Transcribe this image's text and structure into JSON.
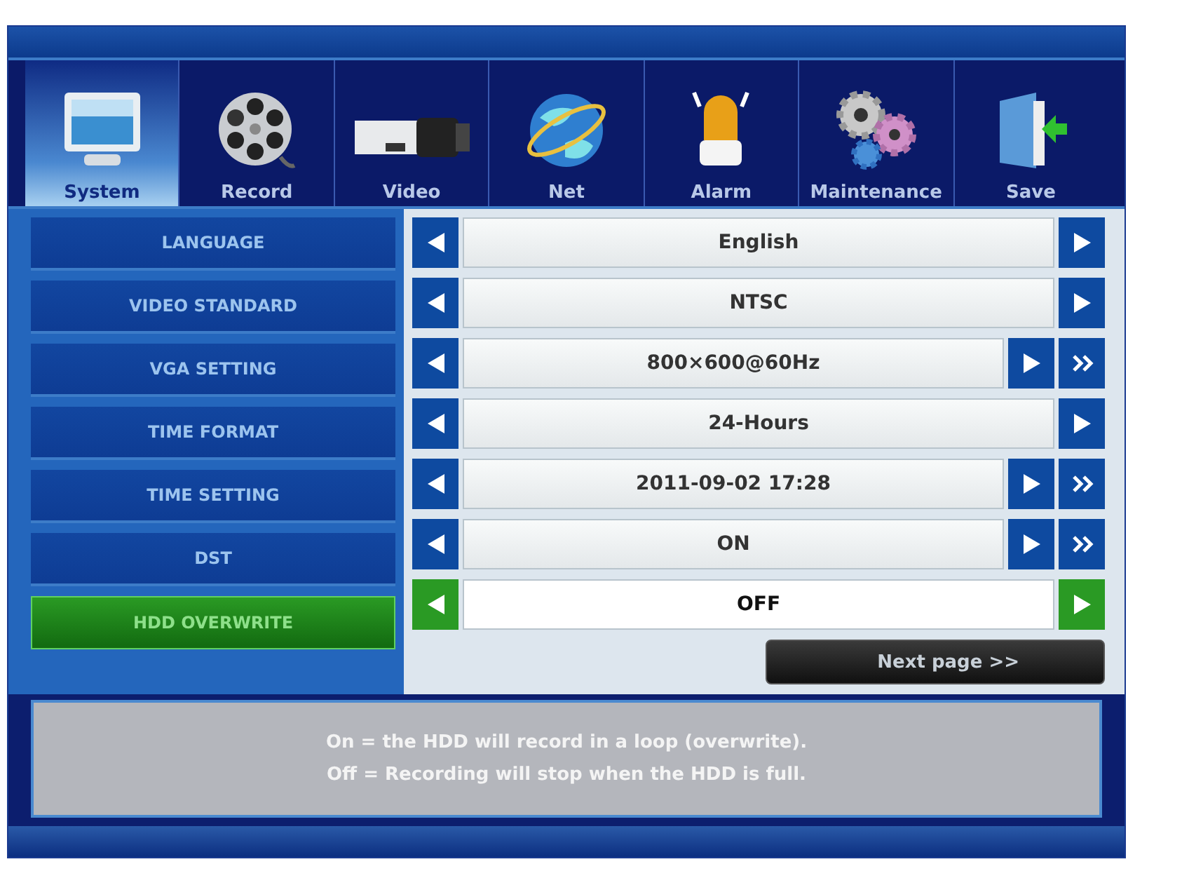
{
  "tabs": [
    {
      "label": "System",
      "selected": true
    },
    {
      "label": "Record",
      "selected": false
    },
    {
      "label": "Video",
      "selected": false
    },
    {
      "label": "Net",
      "selected": false
    },
    {
      "label": "Alarm",
      "selected": false
    },
    {
      "label": "Maintenance",
      "selected": false
    },
    {
      "label": "Save",
      "selected": false
    }
  ],
  "settings": [
    {
      "label": "LANGUAGE",
      "value": "English",
      "selected": false,
      "has_more": false
    },
    {
      "label": "VIDEO STANDARD",
      "value": "NTSC",
      "selected": false,
      "has_more": false
    },
    {
      "label": "VGA SETTING",
      "value": "800×600@60Hz",
      "selected": false,
      "has_more": true
    },
    {
      "label": "TIME FORMAT",
      "value": "24-Hours",
      "selected": false,
      "has_more": false
    },
    {
      "label": "TIME SETTING",
      "value": "2011-09-02 17:28",
      "selected": false,
      "has_more": true
    },
    {
      "label": "DST",
      "value": "ON",
      "selected": false,
      "has_more": true
    },
    {
      "label": "HDD OVERWRITE",
      "value": "OFF",
      "selected": true,
      "has_more": false
    }
  ],
  "next_button": "Next page >>",
  "help": [
    "On = the HDD will record in a loop (overwrite).",
    "Off = Recording will stop when the HDD is full."
  ]
}
